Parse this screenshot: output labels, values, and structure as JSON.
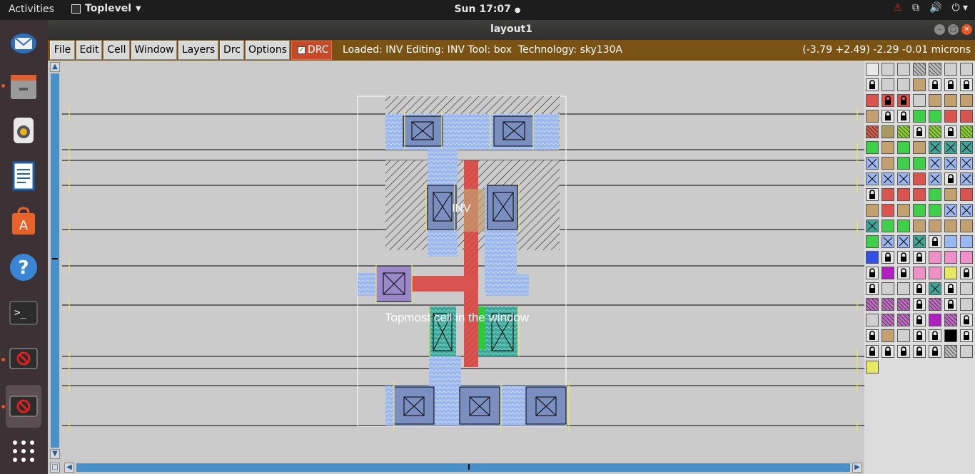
{
  "topbar": {
    "activities": "Activities",
    "app_name": "Toplevel",
    "clock": "Sun 17:07"
  },
  "window": {
    "title": "layout1"
  },
  "menu": {
    "items": [
      "File",
      "Edit",
      "Cell",
      "Window",
      "Layers",
      "Drc",
      "Options"
    ],
    "drc_toggle": "DRC"
  },
  "status": {
    "text": "Loaded: INV Editing: INV Tool: box  Technology: sky130A",
    "coords": "(-3.79 +2.49) -2.29 -0.01 microns"
  },
  "layout": {
    "cell_label": "INV",
    "window_label": "Topmost cell in the window"
  },
  "colors": {
    "menu_bg": "#7a5213",
    "drc_bg": "#c64a2a",
    "poly": "#d9534f",
    "diffusion_blue": "#9ab7f0",
    "diffusion_teal": "#3aa89a",
    "green": "#2fc83a",
    "brown": "#c2a070",
    "yellow": "#e8e860"
  },
  "dock": {
    "icons": [
      "thunderbird-icon",
      "files-icon",
      "rhythmbox-icon",
      "writer-icon",
      "software-icon",
      "help-icon",
      "terminal-icon",
      "app-icon",
      "app-icon-active",
      "show-apps-icon"
    ]
  }
}
